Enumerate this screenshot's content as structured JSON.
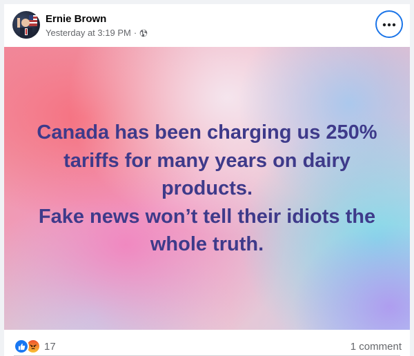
{
  "post": {
    "author": "Ernie Brown",
    "timestamp": "Yesterday at 3:19 PM",
    "separator": "·",
    "privacy_icon": "globe-icon",
    "more_icon": "more-horizontal-icon",
    "text_lines": [
      "Canada has been charging us 250%",
      "tariffs for many years on dairy",
      "products.",
      "Fake news won’t tell their idiots the",
      "whole truth."
    ],
    "text_color": "#3e3a8a"
  },
  "footer": {
    "reaction_icons": [
      "like-icon",
      "angry-icon"
    ],
    "reaction_count": "17",
    "comment_count": "1 comment"
  },
  "colors": {
    "accent": "#1a74e8",
    "like": "#1877f2",
    "secondary_text": "#65676b"
  }
}
